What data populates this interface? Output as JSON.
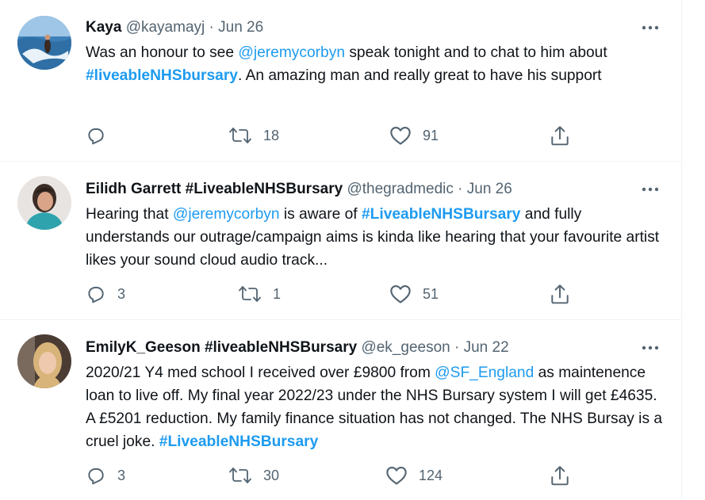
{
  "tweets": [
    {
      "name": "Kaya",
      "handle": "@kayamayj",
      "separator": "·",
      "date": "Jun 26",
      "text": [
        {
          "t": "text",
          "v": "Was an honour to see "
        },
        {
          "t": "link",
          "v": "@jeremycorbyn"
        },
        {
          "t": "text",
          "v": " speak tonight and to chat to him about "
        },
        {
          "t": "hash",
          "v": "#liveableNHSbursary"
        },
        {
          "t": "text",
          "v": ". An amazing man and really great to have his support"
        }
      ],
      "replies": "",
      "retweets": "18",
      "likes": "91"
    },
    {
      "name": "Eilidh Garrett #LiveableNHSBursary",
      "handle": "@thegradmedic",
      "separator": "·",
      "date": "Jun 26",
      "text": [
        {
          "t": "text",
          "v": "Hearing that "
        },
        {
          "t": "link",
          "v": "@jeremycorbyn"
        },
        {
          "t": "text",
          "v": " is aware of "
        },
        {
          "t": "hash",
          "v": "#LiveableNHSBursary"
        },
        {
          "t": "text",
          "v": " and fully understands our outrage/campaign aims is kinda like hearing that your favourite artist likes your sound cloud audio track..."
        }
      ],
      "replies": "3",
      "retweets": "1",
      "likes": "51"
    },
    {
      "name": "EmilyK_Geeson #liveableNHSBursary",
      "handle": "@ek_geeson",
      "separator": "·",
      "date": "Jun 22",
      "text": [
        {
          "t": "text",
          "v": "2020/21 Y4 med school I received over £9800 from "
        },
        {
          "t": "link",
          "v": "@SF_England"
        },
        {
          "t": "text",
          "v": " as maintenence loan to live off. My final year 2022/23 under the NHS Bursary system I will get £4635. A £5201 reduction. My family finance situation has not changed. The NHS Bursay is a cruel joke. "
        },
        {
          "t": "hash",
          "v": "#LiveableNHSBursary"
        }
      ],
      "replies": "3",
      "retweets": "30",
      "likes": "124"
    }
  ],
  "icons": {
    "reply": "reply-icon",
    "retweet": "retweet-icon",
    "like": "heart-icon",
    "share": "share-icon",
    "more": "more-icon"
  },
  "colors": {
    "link": "#1d9bf0",
    "secondary_text": "#536471",
    "primary_text": "#0f1419",
    "divider": "#eff3f4"
  }
}
